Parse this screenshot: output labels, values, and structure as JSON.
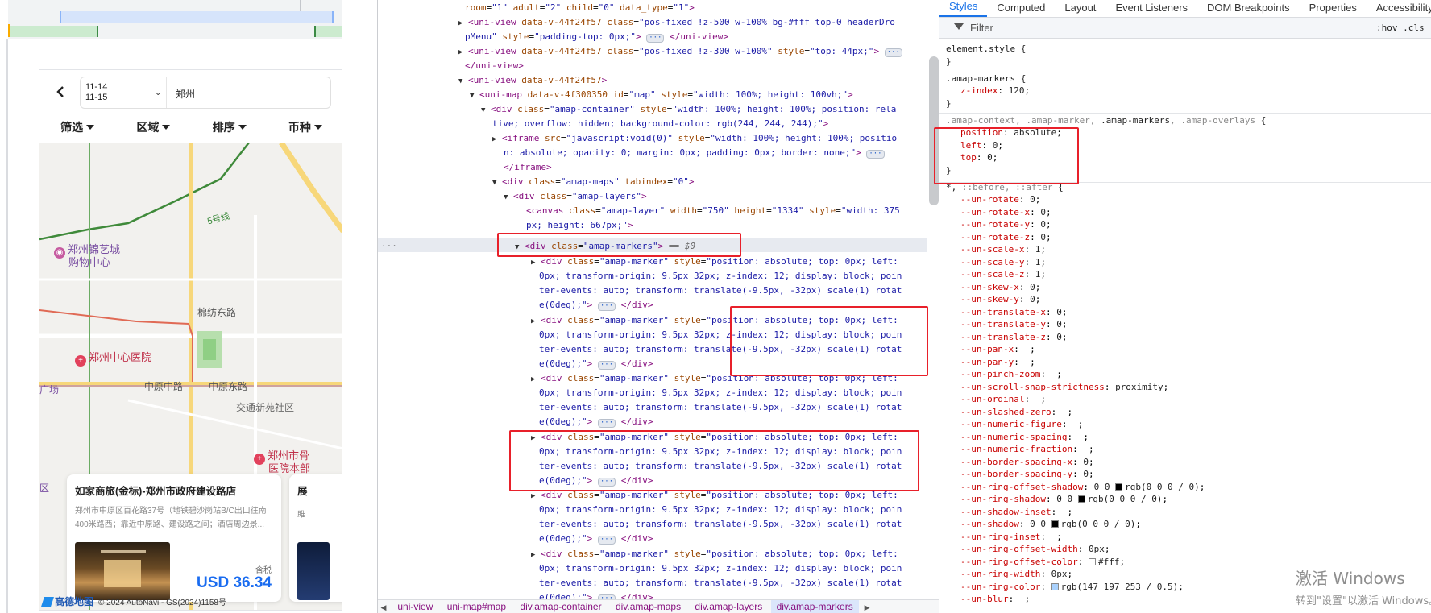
{
  "preview": {
    "header": {
      "check_in": "11-14",
      "check_out": "11-15",
      "city": "郑州"
    },
    "filters": [
      "筛选",
      "区域",
      "排序",
      "币种"
    ],
    "map_labels": {
      "line5": "5号线",
      "poi_mall_line1": "郑州锦艺城",
      "poi_mall_line2": "购物中心",
      "road_mianfang": "棉纺东路",
      "hospital": "郑州中心医院",
      "road_zhongyuan": "中原中路",
      "road_zhongyuan_east": "中原东路",
      "left_edge": "广场",
      "jiaotong": "交通新苑社区",
      "hospital2_line1": "郑州市骨",
      "hospital2_line2": "医院本部",
      "left_edge2": "区"
    },
    "card": {
      "title": "如家商旅(金标)-郑州市政府建设路店",
      "address": "郑州市中原区百花路37号（地铁碧沙岗站B/C出口往南400米路西；靠近中原路、建设路之间；酒店周边景...",
      "tax_label": "含税",
      "price": "USD 36.34"
    },
    "card2": {
      "title": "展",
      "address": "雎"
    },
    "map_footer": {
      "logo": "高德地图",
      "copyright": "© 2024 AutoNavi - GS(2024)1158号"
    }
  },
  "elements_panel": {
    "breadcrumbs": [
      "uni-view",
      "uni-map#map",
      "div.amap-container",
      "div.amap-maps",
      "div.amap-layers",
      "div.amap-markers"
    ],
    "selected_suffix": "== $0",
    "gutter": "..."
  },
  "styles_panel": {
    "tabs": [
      "Styles",
      "Computed",
      "Layout",
      "Event Listeners",
      "DOM Breakpoints",
      "Properties",
      "Accessibility"
    ],
    "filter_placeholder": "Filter",
    "hov_cls": ":hov  .cls"
  },
  "watermark": {
    "line1": "激活 Windows",
    "line2": "转到\"设置\"以激活 Windows。"
  },
  "colors": {
    "accent": "#1a73e8",
    "price": "#1a6cf0",
    "highlight_box": "#e8202a"
  }
}
